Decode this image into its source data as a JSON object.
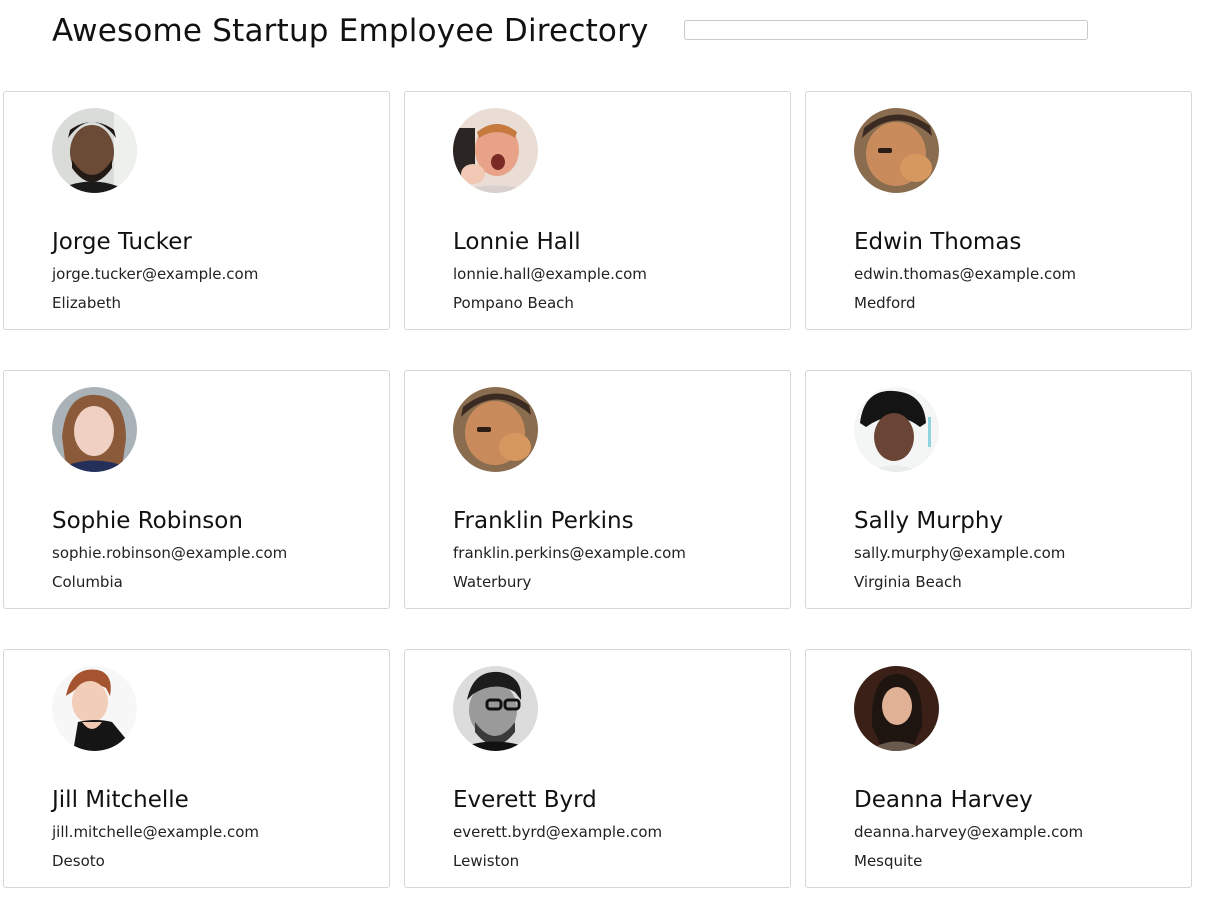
{
  "header": {
    "title": "Awesome Startup Employee Directory",
    "search_placeholder": ""
  },
  "employees": [
    {
      "name": "Jorge Tucker",
      "email": "jorge.tucker@example.com",
      "city": "Elizabeth",
      "avatar": "person-photo-icon"
    },
    {
      "name": "Lonnie Hall",
      "email": "lonnie.hall@example.com",
      "city": "Pompano Beach",
      "avatar": "person-photo-icon"
    },
    {
      "name": "Edwin Thomas",
      "email": "edwin.thomas@example.com",
      "city": "Medford",
      "avatar": "person-photo-icon"
    },
    {
      "name": "Sophie Robinson",
      "email": "sophie.robinson@example.com",
      "city": "Columbia",
      "avatar": "person-photo-icon"
    },
    {
      "name": "Franklin Perkins",
      "email": "franklin.perkins@example.com",
      "city": "Waterbury",
      "avatar": "person-photo-icon"
    },
    {
      "name": "Sally Murphy",
      "email": "sally.murphy@example.com",
      "city": "Virginia Beach",
      "avatar": "person-photo-icon"
    },
    {
      "name": "Jill Mitchelle",
      "email": "jill.mitchelle@example.com",
      "city": "Desoto",
      "avatar": "person-photo-icon"
    },
    {
      "name": "Everett Byrd",
      "email": "everett.byrd@example.com",
      "city": "Lewiston",
      "avatar": "person-photo-icon"
    },
    {
      "name": "Deanna Harvey",
      "email": "deanna.harvey@example.com",
      "city": "Mesquite",
      "avatar": "person-photo-icon"
    }
  ]
}
